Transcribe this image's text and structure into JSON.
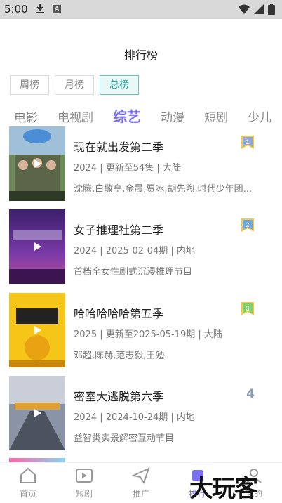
{
  "status_bar": {
    "time": "5:00",
    "icons": [
      "download-icon",
      "a-icon",
      "wifi-icon",
      "signal-icon",
      "battery-icon"
    ]
  },
  "header": {
    "title": "排行榜"
  },
  "period_tabs": [
    {
      "label": "周榜",
      "active": false
    },
    {
      "label": "月榜",
      "active": false
    },
    {
      "label": "总榜",
      "active": true
    }
  ],
  "category_tabs": [
    {
      "label": "电影",
      "active": false
    },
    {
      "label": "电视剧",
      "active": false
    },
    {
      "label": "综艺",
      "active": true
    },
    {
      "label": "动漫",
      "active": false
    },
    {
      "label": "短剧",
      "active": false
    },
    {
      "label": "少儿",
      "active": false
    }
  ],
  "items": [
    {
      "rank": "1",
      "title": "现在就出发第二季",
      "meta": "2024 | 更新至54集 | 大陆",
      "desc": "沈腾,白敬亭,金晨,贾冰,胡先煦,时代少年团...",
      "badge_color": "#8ea6d8"
    },
    {
      "rank": "2",
      "title": "女子推理社第二季",
      "meta": "2024 | 2025-02-04期 | 内地",
      "desc": "首档全女性剧式沉浸推理节目",
      "badge_color": "#6fa7e3"
    },
    {
      "rank": "3",
      "title": "哈哈哈哈哈第五季",
      "meta": "2025 | 更新至2025-05-19期 | 大陆",
      "desc": "邓超,陈赫,范志毅,王勉",
      "badge_color": "#7fcf6a"
    },
    {
      "rank": "4",
      "title": "密室大逃脱第六季",
      "meta": "2024 | 2024-10-24期 | 内地",
      "desc": "益智类实景解密互动节目"
    }
  ],
  "bottom_nav": [
    {
      "label": "首页",
      "icon": "home-icon",
      "active": false
    },
    {
      "label": "短剧",
      "icon": "play-box-icon",
      "active": false
    },
    {
      "label": "推广",
      "icon": "paper-plane-icon",
      "active": false
    },
    {
      "label": "排行",
      "icon": "ranking-icon",
      "active": true
    },
    {
      "label": "我的",
      "icon": "user-icon",
      "active": false
    }
  ],
  "watermark": "大玩客"
}
